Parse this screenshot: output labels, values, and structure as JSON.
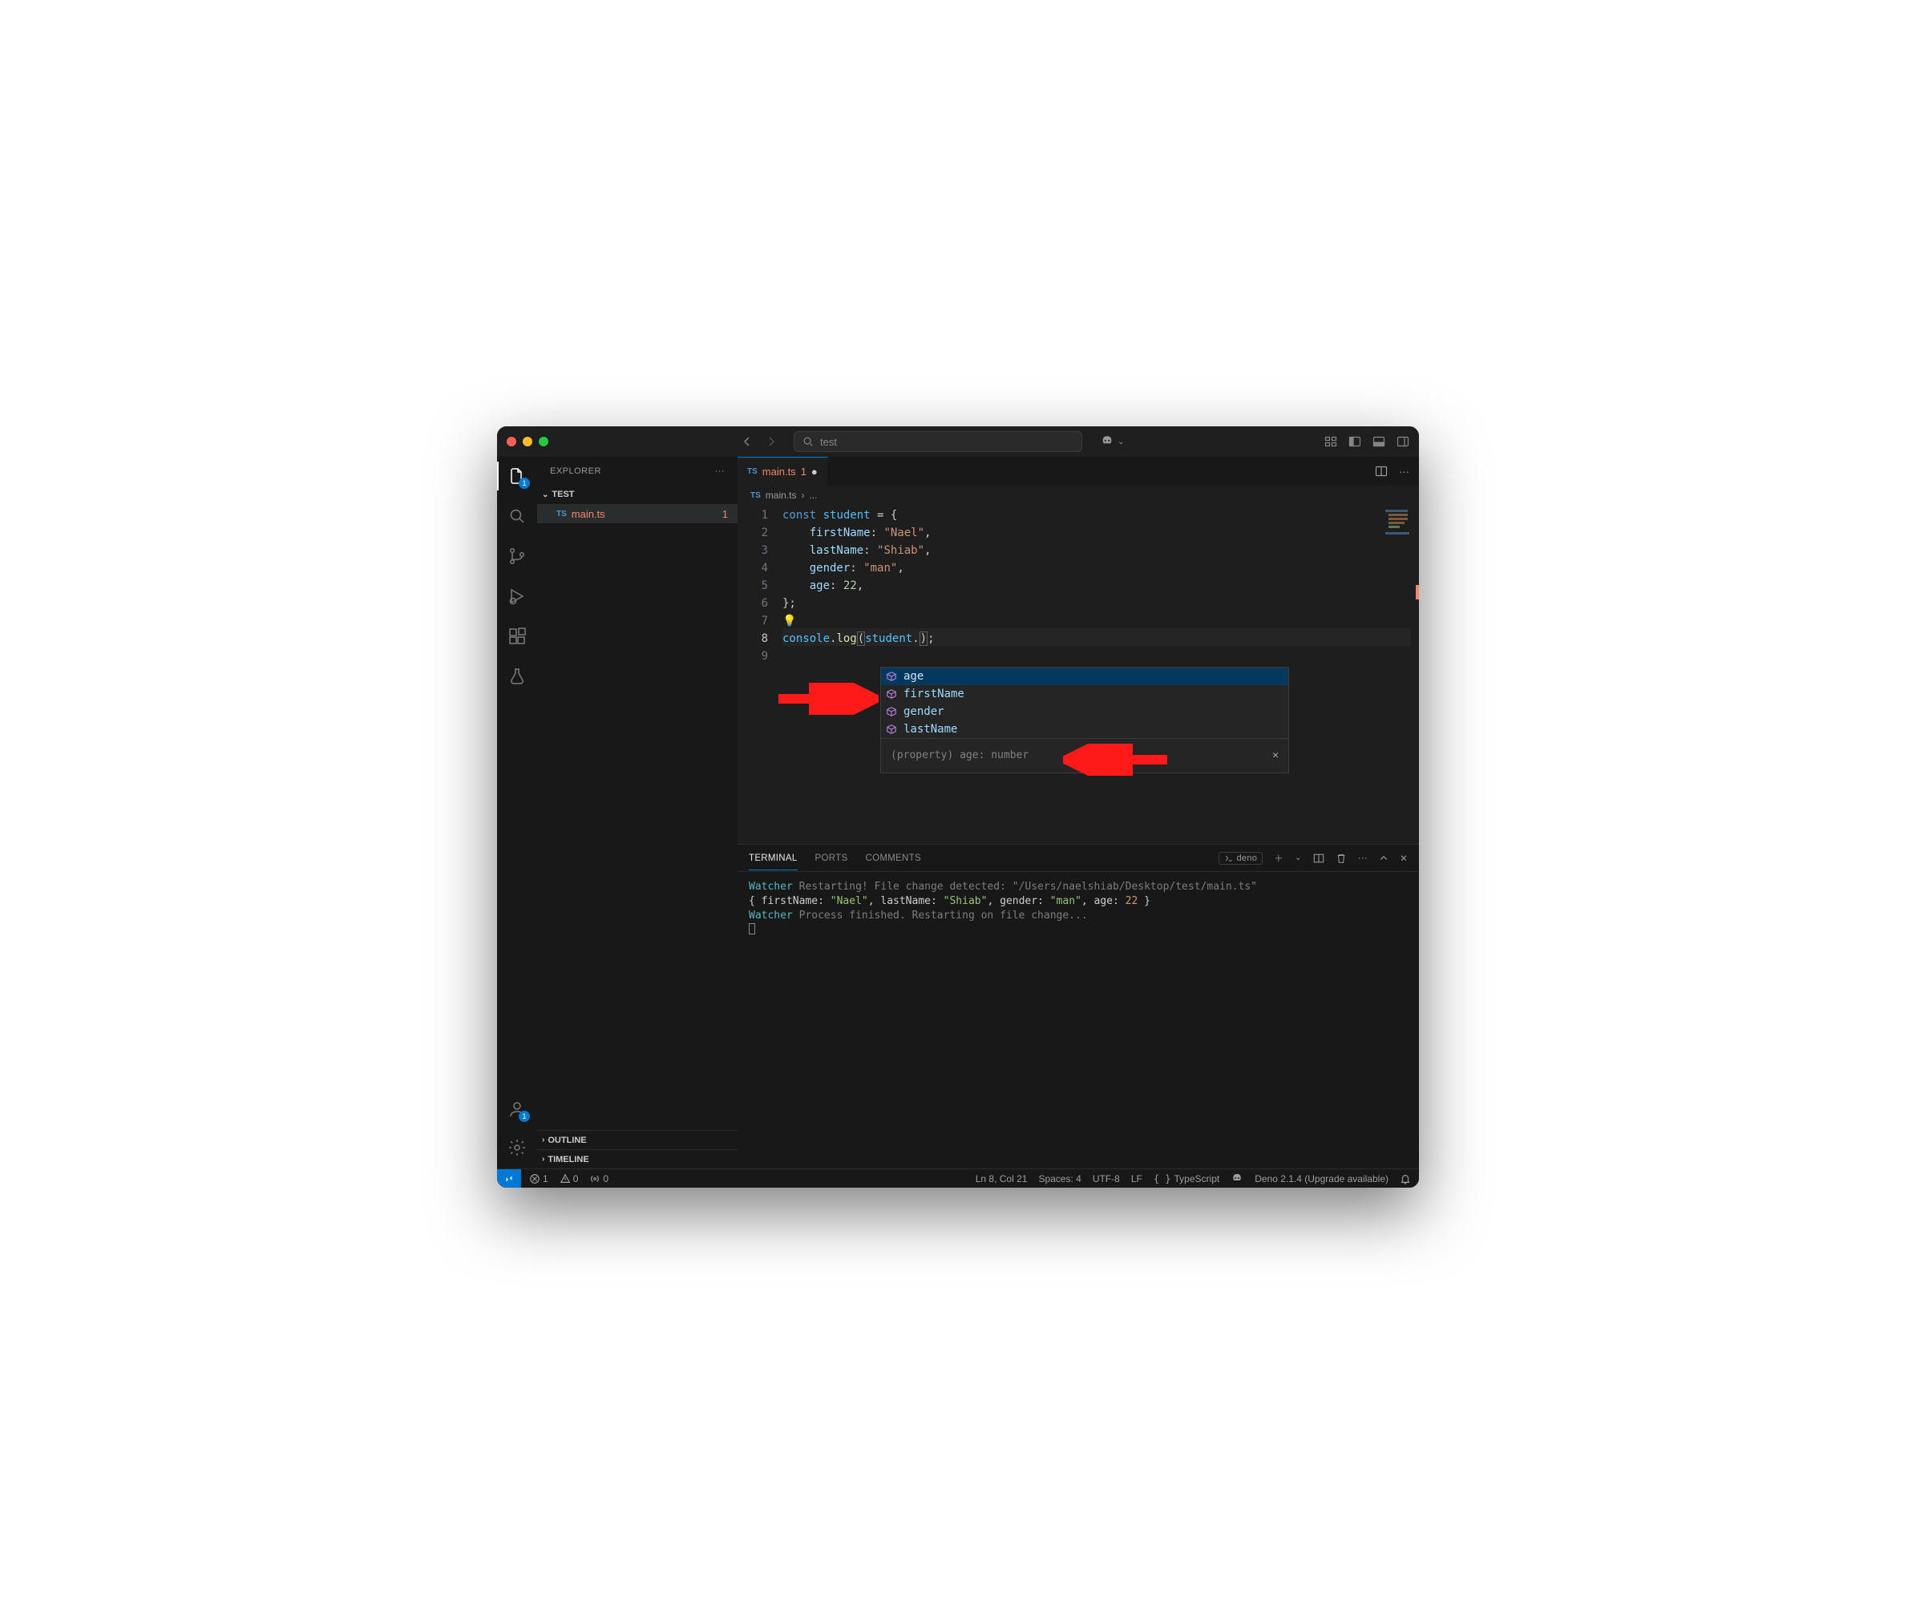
{
  "titlebar": {
    "search_placeholder": "test"
  },
  "activitybar": {
    "explorer_badge": "1",
    "accounts_badge": "1"
  },
  "sidebar": {
    "title": "EXPLORER",
    "root_folder": "TEST",
    "files": [
      {
        "name": "main.ts",
        "problems": "1"
      }
    ],
    "sections": {
      "outline": "OUTLINE",
      "timeline": "TIMELINE"
    }
  },
  "tabs": {
    "open": {
      "name": "main.ts",
      "problems": "1"
    }
  },
  "breadcrumbs": {
    "file": "main.ts",
    "sep": "›",
    "more": "..."
  },
  "editor": {
    "lines": {
      "l1": "1",
      "l2": "2",
      "l3": "3",
      "l4": "4",
      "l5": "5",
      "l6": "6",
      "l7": "7",
      "l8": "8",
      "l9": "9"
    },
    "code": {
      "kw_const": "const",
      "varname": "student",
      "firstName_key": "firstName",
      "firstName_val": "\"Nael\"",
      "lastName_key": "lastName",
      "lastName_val": "\"Shiab\"",
      "gender_key": "gender",
      "gender_val": "\"man\"",
      "age_key": "age",
      "age_val": "22",
      "console": "console",
      "log": "log",
      "ref": "student"
    }
  },
  "suggest": {
    "items": [
      {
        "label": "age"
      },
      {
        "label": "firstName"
      },
      {
        "label": "gender"
      },
      {
        "label": "lastName"
      }
    ],
    "detail": "(property) age: number"
  },
  "panel": {
    "tabs": {
      "terminal": "TERMINAL",
      "ports": "PORTS",
      "comments": "COMMENTS"
    },
    "profile": "deno",
    "terminal": {
      "watcher": "Watcher",
      "restart_msg": "Restarting! File change detected:",
      "file_path": "\"/Users/naelshiab/Desktop/test/main.ts\"",
      "obj_open": "{ firstName:",
      "v_firstName": "\"Nael\"",
      "sep1": ", lastName:",
      "v_lastName": "\"Shiab\"",
      "sep2": ", gender:",
      "v_gender": "\"man\"",
      "sep3": ", age:",
      "v_age": "22",
      "obj_close": " }",
      "finished_msg": "Process finished. Restarting on file change..."
    }
  },
  "statusbar": {
    "errors": "1",
    "warnings": "0",
    "ports": "0",
    "ln_col": "Ln 8, Col 21",
    "spaces": "Spaces: 4",
    "encoding": "UTF-8",
    "eol": "LF",
    "lang": "TypeScript",
    "deno": "Deno 2.1.4 (Upgrade available)"
  }
}
